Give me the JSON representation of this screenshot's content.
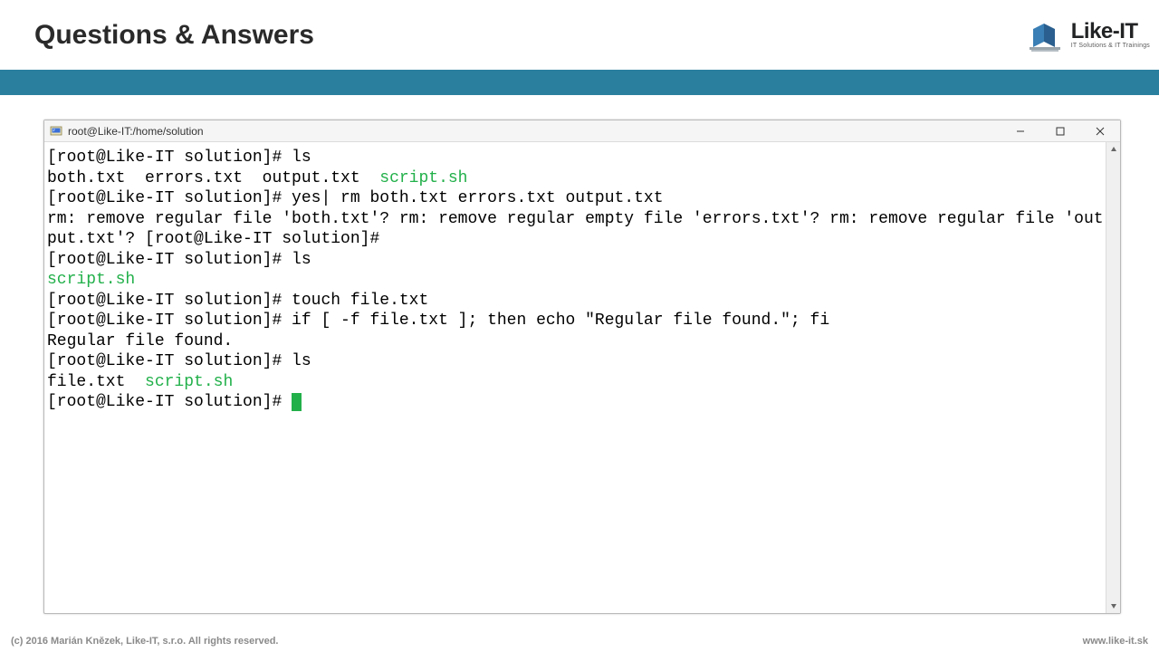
{
  "header": {
    "title": "Questions & Answers",
    "logo_main": "Like-IT",
    "logo_sub": "IT Solutions & IT Trainings"
  },
  "terminal": {
    "window_title": "root@Like-IT:/home/solution",
    "prompt": "[root@Like-IT solution]# ",
    "lines": {
      "l0_cmd": "ls",
      "l1a": "both.txt  errors.txt  output.txt  ",
      "l1b_green": "script.sh",
      "l2_cmd": "yes| rm both.txt errors.txt output.txt",
      "l3": "rm: remove regular file 'both.txt'? rm: remove regular empty file 'errors.txt'? rm: remove regular file 'output.txt'? [root@Like-IT solution]#",
      "l4_cmd": "ls",
      "l5_green": "script.sh",
      "l6_cmd": "touch file.txt",
      "l7_cmd": "if [ -f file.txt ]; then echo \"Regular file found.\"; fi",
      "l8": "Regular file found.",
      "l9_cmd": "ls",
      "l10a": "file.txt  ",
      "l10b_green": "script.sh"
    }
  },
  "footer": {
    "copyright": "(c) 2016 Marián Knězek, Like-IT, s.r.o. All rights reserved.",
    "url": "www.like-it.sk"
  }
}
